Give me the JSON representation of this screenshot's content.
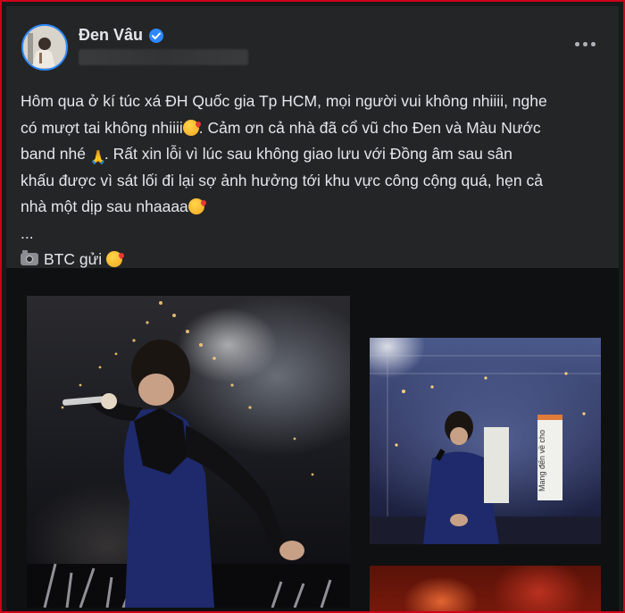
{
  "post": {
    "author": "Đen Vâu",
    "verified": true,
    "lines": [
      "Hôm qua ở kí túc xá ĐH Quốc gia Tp HCM, mọi người vui không nhiiii, nghe",
      "có mượt tai không nhiiii",
      ". Cảm ơn cả nhà đã cổ vũ cho Đen và Màu Nước",
      "band nhé",
      ". Rất xin lỗi vì lúc sau không giao lưu với Đồng âm sau sân",
      "khấu được vì sát lối đi lại sợ ảnh hưởng tới khu vực công cộng quá, hẹn cả",
      "nhà một dịp sau nhaaaa",
      "...",
      "BTC gửi"
    ],
    "emoji": [
      "kiss-emoji",
      "pray-emoji",
      "camera-emoji"
    ]
  },
  "media": {
    "side_banner_text": "Mang đến về cho"
  },
  "colors": {
    "frame_border": "#d0021b",
    "card_bg": "#242526",
    "text": "#e4e6eb",
    "verified": "#2d88ff"
  }
}
